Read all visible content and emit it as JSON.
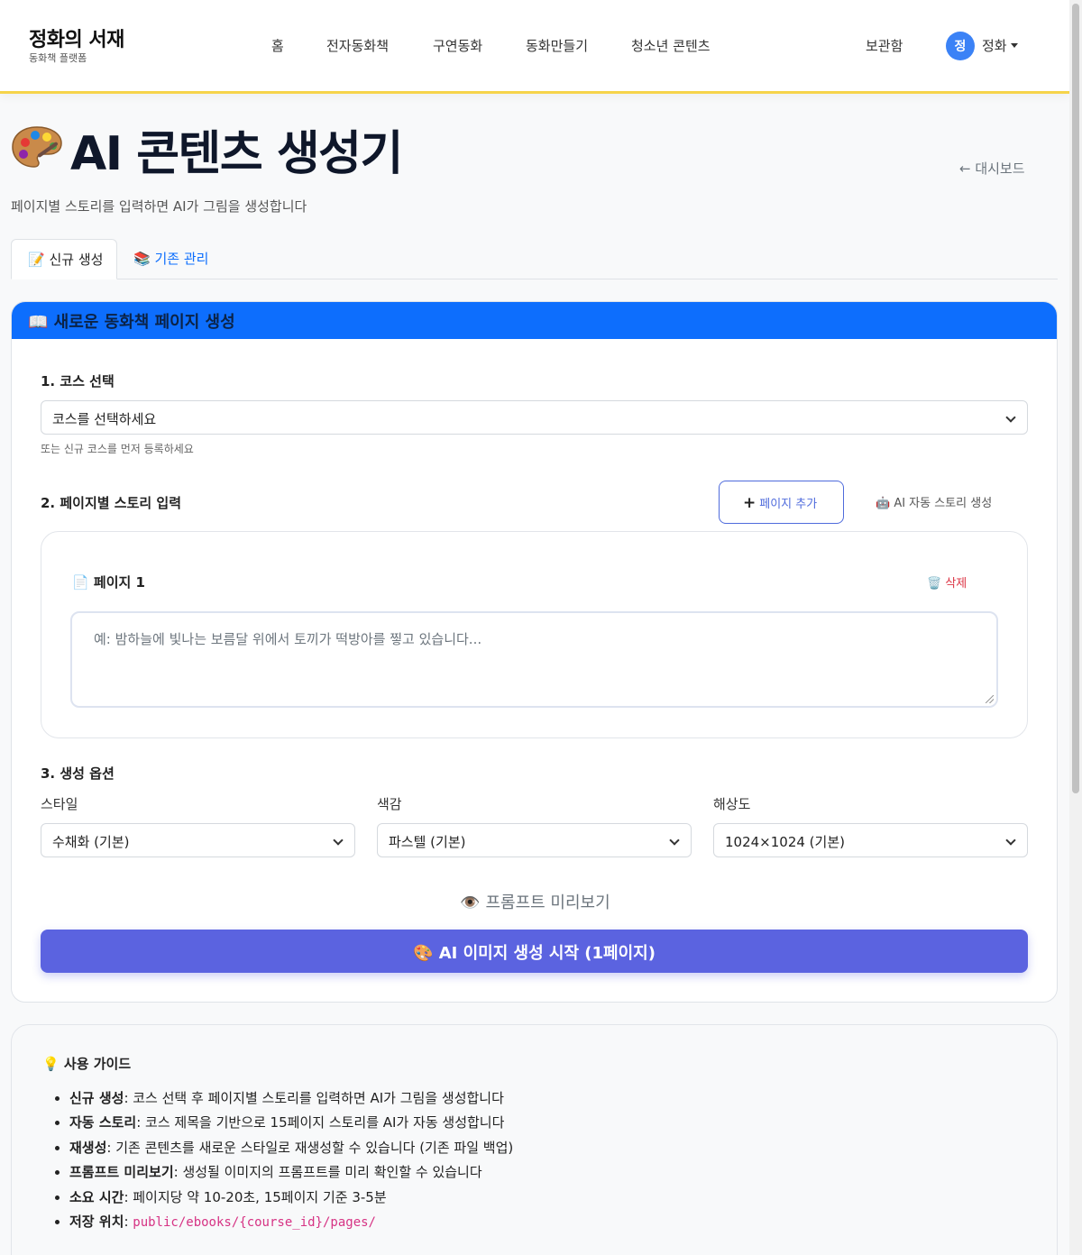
{
  "header": {
    "brand_title": "정화의 서재",
    "brand_sub": "동화책 플랫폼",
    "nav": [
      "홈",
      "전자동화책",
      "구연동화",
      "동화만들기",
      "청소년 콘텐츠"
    ],
    "storage": "보관함",
    "user_initial": "정",
    "user_name": "정화"
  },
  "page": {
    "title": "AI 콘텐츠 생성기",
    "subtitle": "페이지별 스토리를 입력하면 AI가 그림을 생성합니다",
    "back_link": "← 대시보드"
  },
  "tabs": {
    "new": "📝 신규 생성",
    "existing": "📚 기존 관리"
  },
  "card": {
    "header": "📖 새로운 동화책 페이지 생성",
    "step1_label": "1. 코스 선택",
    "course_select": "코스를 선택하세요",
    "course_hint": "또는 신규 코스를 먼저 등록하세요",
    "step2_label": "2. 페이지별 스토리 입력",
    "add_page": "페이지 추가",
    "add_page_icon": "+",
    "auto_story": "🤖 AI 자동 스토리 생성",
    "page_label": "📄 페이지 1",
    "delete": "🗑️ 삭제",
    "story_placeholder": "예: 밤하늘에 빛나는 보름달 위에서 토끼가 떡방아를 찧고 있습니다...",
    "step3_label": "3. 생성 옵션",
    "style_label": "스타일",
    "style_value": "수채화 (기본)",
    "color_label": "색감",
    "color_value": "파스텔 (기본)",
    "resolution_label": "해상도",
    "resolution_value": "1024×1024 (기본)",
    "preview": "👁️ 프롬프트 미리보기",
    "generate": "🎨 AI 이미지 생성 시작 (1페이지)"
  },
  "guide": {
    "title": "💡 사용 가이드",
    "items": [
      {
        "term": "신규 생성",
        "desc": ": 코스 선택 후 페이지별 스토리를 입력하면 AI가 그림을 생성합니다"
      },
      {
        "term": "자동 스토리",
        "desc": ": 코스 제목을 기반으로 15페이지 스토리를 AI가 자동 생성합니다"
      },
      {
        "term": "재생성",
        "desc": ": 기존 콘텐츠를 새로운 스타일로 재생성할 수 있습니다 (기존 파일 백업)"
      },
      {
        "term": "프롬프트 미리보기",
        "desc": ": 생성될 이미지의 프롬프트를 미리 확인할 수 있습니다"
      },
      {
        "term": "소요 시간",
        "desc": ": 페이지당 약 10-20초, 15페이지 기준 3-5분"
      },
      {
        "term": "저장 위치",
        "desc": ": ",
        "code": "public/ebooks/{course_id}/pages/"
      }
    ]
  },
  "colors": {
    "accent": "#0d6efd",
    "generate": "#5b63e0",
    "header_border": "#f6d44a",
    "danger": "#dc3545"
  },
  "icons": [
    "palette-icon",
    "book-icon",
    "memo-icon",
    "books-icon",
    "robot-icon",
    "page-icon",
    "trash-icon",
    "eye-icon",
    "bulb-icon"
  ]
}
